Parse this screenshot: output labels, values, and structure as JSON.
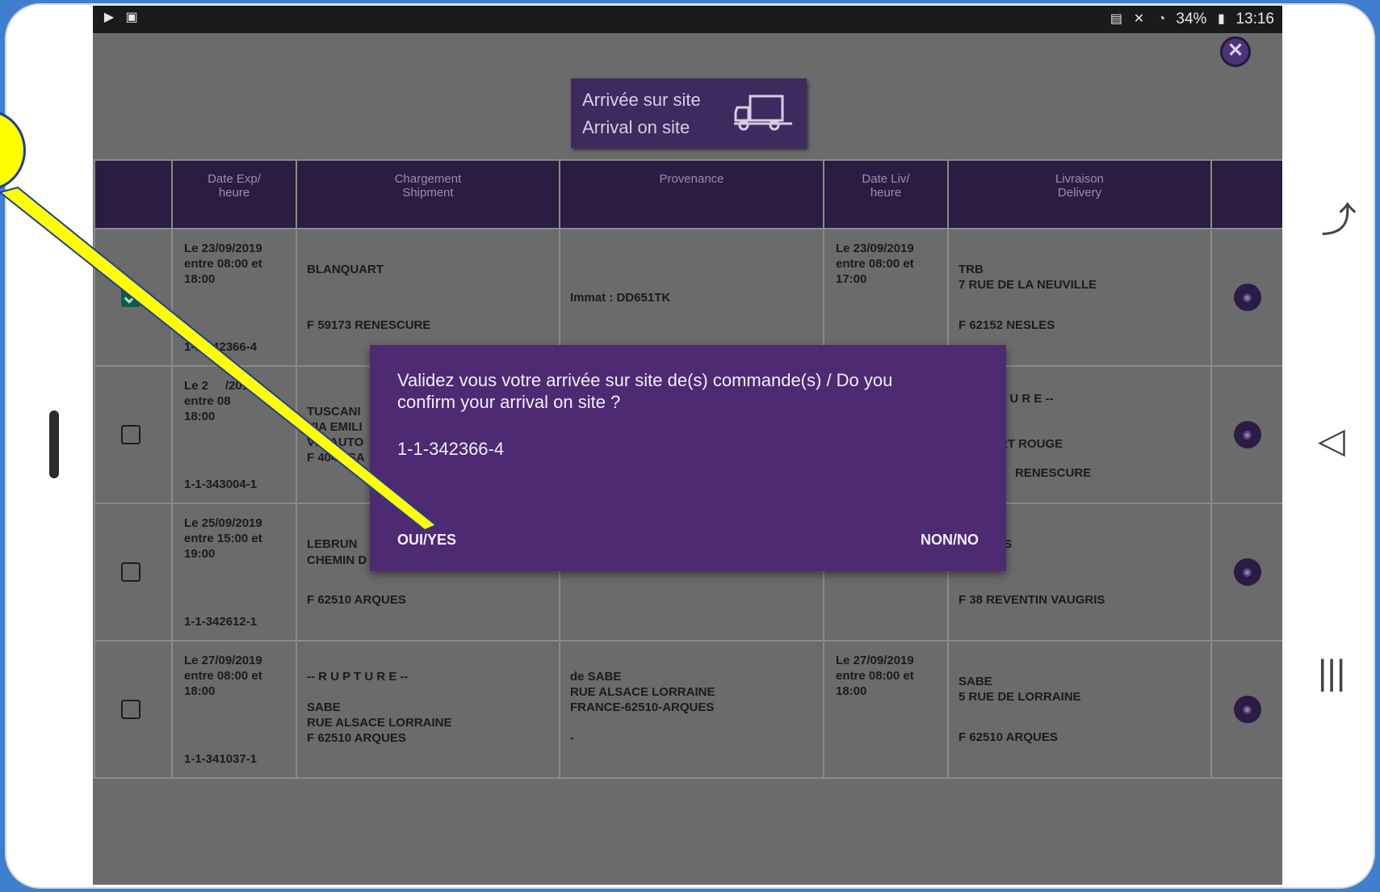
{
  "statusbar": {
    "left_icons": [
      "play-store-icon",
      "gallery-icon"
    ],
    "battery": "34%",
    "time": "13:16"
  },
  "header": {
    "arrival_line1": "Arrivée sur site",
    "arrival_line2": "Arrival on site"
  },
  "table": {
    "columns": [
      "",
      "Date Exp/ heure",
      "Chargement Shipment",
      "Provenance",
      "Date Liv/ heure",
      "Livraison Delivery",
      ""
    ],
    "col_date_exp_1": "Date Exp/",
    "col_date_exp_2": "heure",
    "col_ship_1": "Chargement",
    "col_ship_2": "Shipment",
    "col_prov": "Provenance",
    "col_date_liv_1": "Date Liv/",
    "col_date_liv_2": "heure",
    "col_deliv_1": "Livraison",
    "col_deliv_2": "Delivery",
    "rows": [
      {
        "checked": true,
        "date_exp_1": "Le 23/09/2019",
        "date_exp_2": "entre 08:00 et",
        "date_exp_3": "18:00",
        "ref": "1-1-342366-4",
        "ship_1": "BLANQUART",
        "ship_2": "",
        "ship_3": "F 59173 RENESCURE",
        "prov": "Immat : DD651TK",
        "date_liv_1": "Le 23/09/2019",
        "date_liv_2": "entre 08:00 et",
        "date_liv_3": "17:00",
        "deliv_1": "TRB",
        "deliv_2": "7 RUE DE LA NEUVILLE",
        "deliv_3": "F 62152 NESLES"
      },
      {
        "checked": false,
        "date_exp_1": "Le 2",
        "date_exp_1b": "/2019",
        "date_exp_2": "entre 08",
        "date_exp_3": "18:00",
        "ref": "1-1-343004-1",
        "ship_1": "TUSCANI",
        "ship_2": "VIA EMILI",
        "ship_3": "VIA AUTO",
        "ship_4": "F 4049 SA",
        "prov": "",
        "date_liv_1": "",
        "date_liv_2": "",
        "date_liv_3": "",
        "deliv_1": "T U R E --",
        "deliv_2": "RT ROUGE",
        "deliv_3": "RENESCURE"
      },
      {
        "checked": false,
        "date_exp_1": "Le 25/09/2019",
        "date_exp_2": "entre 15:00 et",
        "date_exp_3": "19:00",
        "ref": "1-1-342612-1",
        "ship_1": "LEBRUN",
        "ship_2": "CHEMIN D",
        "ship_3": "F 62510 ARQUES",
        "prov": "",
        "date_liv_1": "",
        "date_liv_2": "",
        "date_liv_3": "",
        "deliv_1": "S",
        "deliv_2": "",
        "deliv_3": "F 38 REVENTIN VAUGRIS"
      },
      {
        "checked": false,
        "date_exp_1": "Le 27/09/2019",
        "date_exp_2": "entre 08:00 et",
        "date_exp_3": "18:00",
        "ref": "1-1-341037-1",
        "ship_1": "-- R U P T U R E --",
        "ship_2": "SABE",
        "ship_3": "RUE ALSACE LORRAINE",
        "ship_4": "F 62510 ARQUES",
        "prov_1": "de SABE",
        "prov_2": "RUE ALSACE LORRAINE",
        "prov_3": "FRANCE-62510-ARQUES",
        "prov_4": "-",
        "date_liv_1": "Le 27/09/2019",
        "date_liv_2": "entre 08:00 et",
        "date_liv_3": "18:00",
        "deliv_1": "SABE",
        "deliv_2": "5 RUE DE LORRAINE",
        "deliv_3": "F 62510 ARQUES"
      }
    ]
  },
  "dialog": {
    "message_1": "Validez vous votre arrivée sur site de(s) commande(s) / Do you",
    "message_2": "confirm your arrival on site ?",
    "order": "1-1-342366-4",
    "yes": "OUI/YES",
    "no": "NON/NO"
  },
  "colors": {
    "table_header": "#2b1c41",
    "dialog": "#4e2a72",
    "dim_overlay": "#6b6b6b",
    "callout": "#ffff00"
  }
}
